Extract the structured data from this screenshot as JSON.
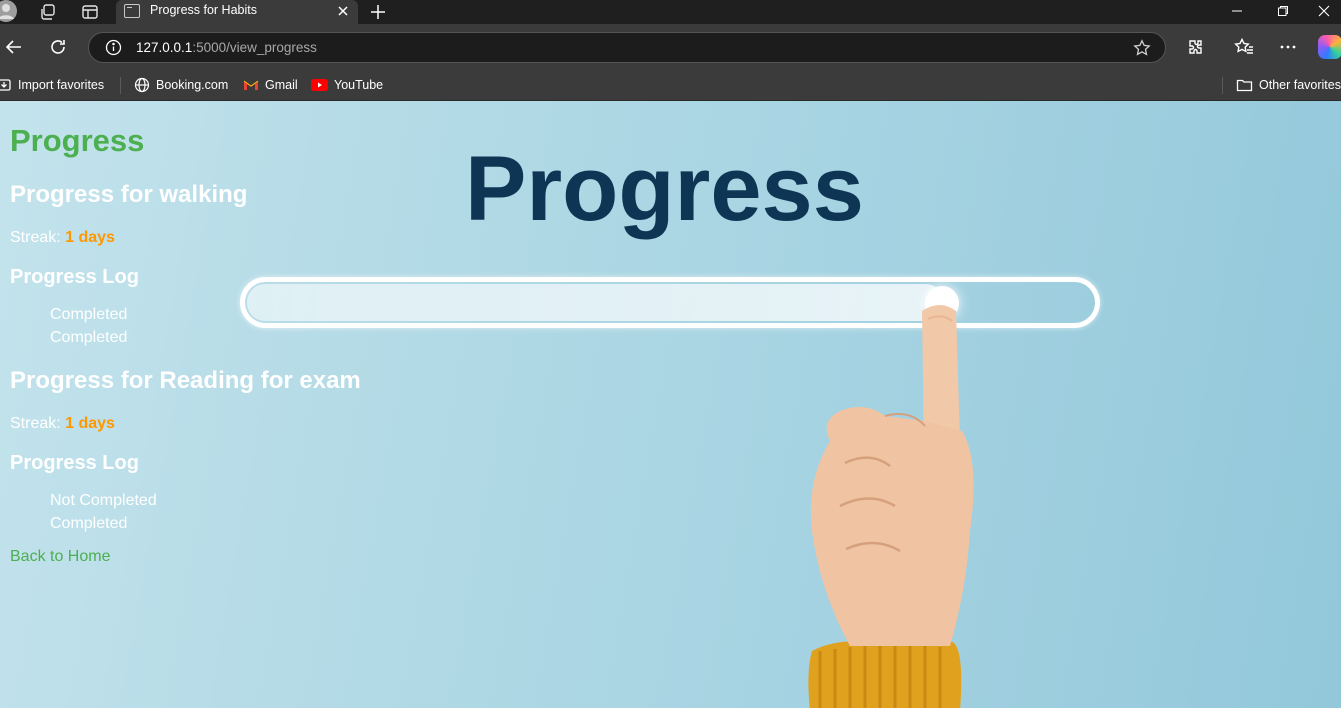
{
  "browser": {
    "tab_title": "Progress for Habits",
    "url_host": "127.0.0.1",
    "url_rest": ":5000/view_progress",
    "favorites": [
      "Import favorites",
      "Booking.com",
      "Gmail",
      "YouTube"
    ],
    "other_favorites": "Other favorites"
  },
  "page": {
    "title": "Progress",
    "hero_text": "Progress",
    "hero_progress": 0.82,
    "habits": [
      {
        "heading": "Progress for walking",
        "streak_label": "Streak:",
        "streak_value": "1 days",
        "log_title": "Progress Log",
        "log": [
          "Completed",
          "Completed"
        ]
      },
      {
        "heading": "Progress for Reading for exam",
        "streak_label": "Streak:",
        "streak_value": "1 days",
        "log_title": "Progress Log",
        "log": [
          "Not Completed",
          "Completed"
        ]
      }
    ],
    "back_link": "Back to Home"
  },
  "colors": {
    "title_green": "#4caf50",
    "streak_orange": "#ff9800",
    "hero_navy": "#0f3555"
  }
}
